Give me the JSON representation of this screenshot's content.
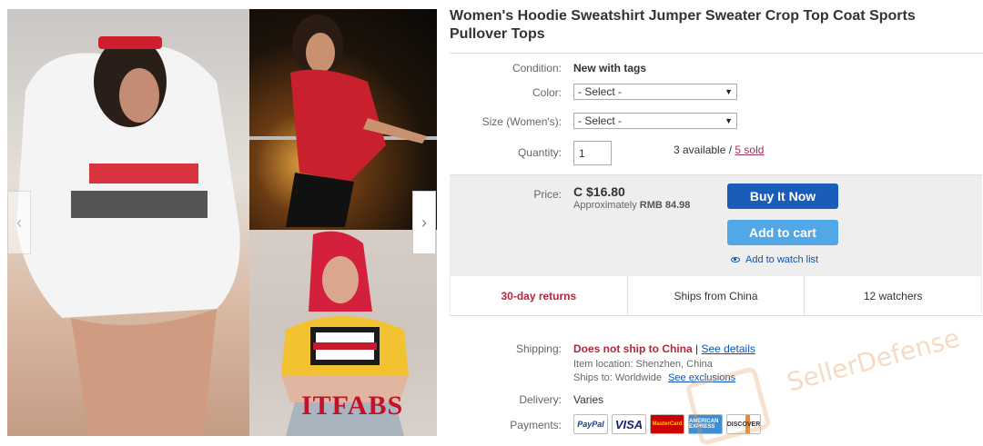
{
  "item": {
    "title": "Women's Hoodie Sweatshirt Jumper Sweater Crop Top Coat Sports Pullover Tops"
  },
  "gallery": {
    "brand_mark": "ITFABS",
    "prev_icon": "chevron-left-icon",
    "next_icon": "chevron-right-icon"
  },
  "labels": {
    "condition": "Condition:",
    "color": "Color:",
    "size": "Size (Women's):",
    "quantity": "Quantity:",
    "price": "Price:",
    "shipping": "Shipping:",
    "delivery": "Delivery:",
    "payments": "Payments:"
  },
  "condition": "New with tags",
  "color_select": {
    "value": "- Select -"
  },
  "size_select": {
    "value": "- Select -"
  },
  "quantity": {
    "value": "1",
    "available": "3 available /",
    "sold": "5 sold"
  },
  "price": {
    "value": "C $16.80",
    "approx_prefix": "Approximately",
    "approx_value": "RMB 84.98"
  },
  "buttons": {
    "buy_now": "Buy It Now",
    "add_to_cart": "Add to cart",
    "watch_list": "Add to watch list"
  },
  "info_cells": [
    "30-day returns",
    "Ships from China",
    "12 watchers"
  ],
  "shipping": {
    "status": "Does not ship to China",
    "separator": "|",
    "details_link": "See details",
    "location": "Item location:  Shenzhen, China",
    "ships_to": "Ships to:  Worldwide",
    "exclusions_link": "See exclusions"
  },
  "delivery": "Varies",
  "payments": [
    "PayPal",
    "VISA",
    "MasterCard",
    "AMERICAN EXPRESS",
    "DISCOVER"
  ],
  "watermark": "SellerDefense",
  "colors": {
    "buy_button": "#1a5cba",
    "cart_button": "#52a8e6",
    "alert_red": "#b3273b",
    "link_blue": "#0654ba"
  }
}
